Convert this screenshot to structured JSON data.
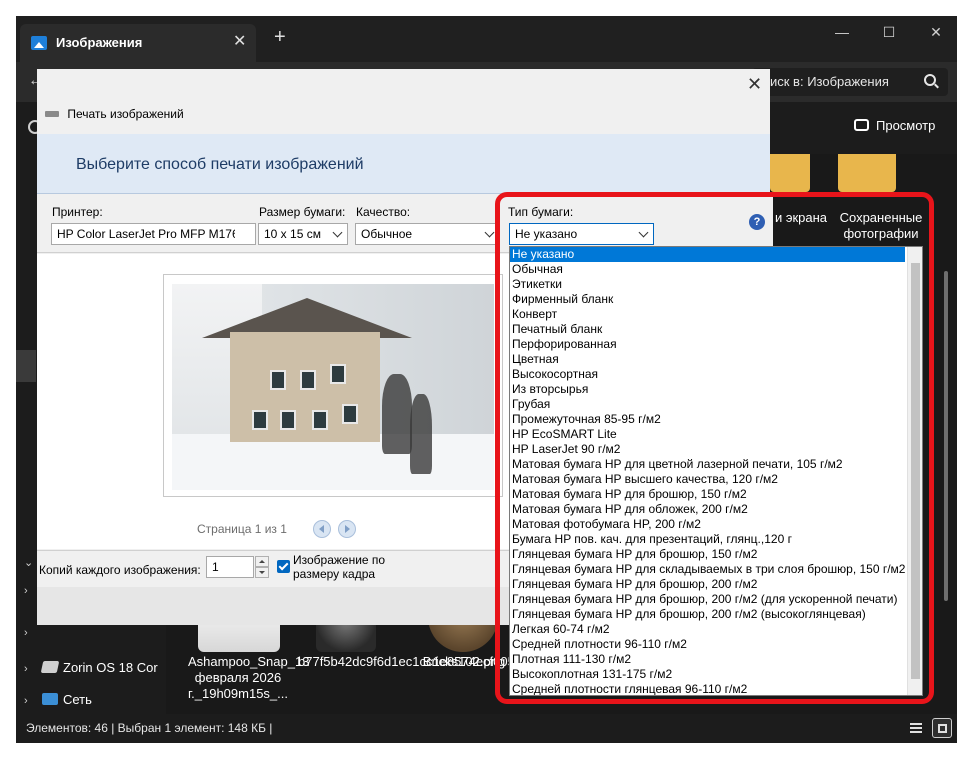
{
  "explorer": {
    "tab_title": "Изображения",
    "tab_close_glyph": "✕",
    "new_tab_glyph": "+",
    "search_placeholder": "иск в: Изображения",
    "preview_label": "Просмотр",
    "folders": [
      {
        "label": "и экрана"
      },
      {
        "label": "Сохраненные фотографии"
      }
    ],
    "sidebar": [
      {
        "label": "Zorin OS 18 Cor"
      },
      {
        "label": "Сеть"
      }
    ],
    "files": [
      {
        "label": "Ashampoo_Snap_13 февраля 2026 г._19h09m15s_..."
      },
      {
        "label": "b77f5b42dc9f6d1ec1cc1e8574ecf005.jpg"
      },
      {
        "label": "Bricks102.png"
      }
    ],
    "status": "Элементов: 46  |  Выбран 1 элемент: 148 КБ  |",
    "colors": {
      "background": "#1c1c1c",
      "folder": "#e8b64c"
    }
  },
  "dialog": {
    "title": "Печать изображений",
    "heading": "Выберите способ печати изображений",
    "printer": {
      "label": "Принтер:",
      "value": "HP Color LaserJet Pro MFP M176"
    },
    "paper_size": {
      "label": "Размер бумаги:",
      "value": "10 x 15 см"
    },
    "quality": {
      "label": "Качество:",
      "value": "Обычное"
    },
    "paper_type": {
      "label": "Тип бумаги:",
      "value": "Не указано",
      "options": [
        "Не указано",
        "Обычная",
        "Этикетки",
        "Фирменный бланк",
        "Конверт",
        "Печатный бланк",
        "Перфорированная",
        "Цветная",
        "Высокосортная",
        "Из вторсырья",
        "Грубая",
        "Промежуточная 85-95 г/м2",
        "HP EcoSMART Lite",
        "HP LaserJet 90 г/м2",
        "Матовая бумага HP для цветной лазерной печати, 105 г/м2",
        "Матовая бумага HP высшего качества, 120 г/м2",
        "Матовая бумага HP для брошюр, 150 г/м2",
        "Матовая бумага HP для обложек, 200 г/м2",
        "Матовая фотобумага HP, 200 г/м2",
        "Бумага HP пов. кач. для презентаций, глянц.,120 г",
        "Глянцевая бумага HP для брошюр, 150 г/м2",
        "Глянцевая бумага HP для складываемых в три слоя брошюр, 150 г/м2",
        "Глянцевая бумага HP для брошюр, 200 г/м2",
        "Глянцевая бумага HP для брошюр, 200 г/м2 (для ускоренной печати)",
        "Глянцевая бумага HP для брошюр, 200 г/м2 (высокоглянцевая)",
        "Легкая 60-74 г/м2",
        "Средней плотности 96-110 г/м2",
        "Плотная 111-130 г/м2",
        "Высокоплотная 131-175 г/м2",
        "Средней плотности глянцевая 96-110 г/м2"
      ]
    },
    "help_glyph": "?",
    "page_indicator": "Страница 1 из 1",
    "copies_label": "Копий каждого изображения:",
    "copies_value": "1",
    "fit_label": "Изображение по размеру кадра",
    "fit_checked": true,
    "close_glyph": "✕",
    "colors": {
      "header": "#dfe9f5",
      "heading_text": "#1e3c66",
      "selection": "#0078d7",
      "highlight": "#e8141a"
    }
  }
}
